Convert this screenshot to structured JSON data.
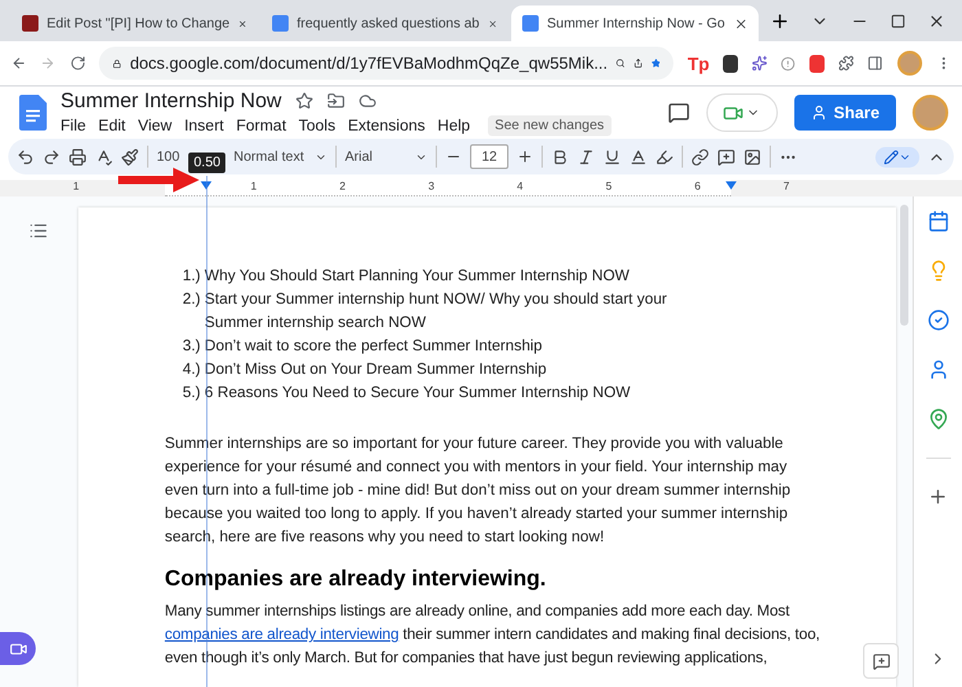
{
  "browser": {
    "tabs": [
      {
        "title": "Edit Post \"[PI] How to Change",
        "kind": "m",
        "selected": false
      },
      {
        "title": "frequently asked questions ab",
        "kind": "g",
        "selected": false
      },
      {
        "title": "Summer Internship Now - Go",
        "kind": "docs",
        "selected": true
      }
    ],
    "url": "docs.google.com/document/d/1y7fEVBaModhmQqZe_qw55Mik...",
    "extension_text": "Tp"
  },
  "doc": {
    "title": "Summer Internship Now",
    "menus": [
      "File",
      "Edit",
      "View",
      "Insert",
      "Format",
      "Tools",
      "Extensions",
      "Help"
    ],
    "changes_chip": "See new changes",
    "share": "Share"
  },
  "toolbar": {
    "zoom": "100",
    "style": "Normal text",
    "font": "Arial",
    "size": "12"
  },
  "ruler": {
    "labels": [
      "1",
      "1",
      "2",
      "3",
      "4",
      "5",
      "6",
      "7"
    ],
    "tooltip": "0.50"
  },
  "content": {
    "list": [
      {
        "number": "1.)",
        "text": "Why You Should Start Planning Your Summer Internship NOW"
      },
      {
        "number": "2.)",
        "text": "Start your Summer internship hunt NOW/ Why you should start your Summer internship search NOW"
      },
      {
        "number": "3.)",
        "text": "Don’t wait to score the perfect Summer Internship"
      },
      {
        "number": "4.)",
        "text": "Don’t Miss Out on Your Dream Summer Internship"
      },
      {
        "number": "5.)",
        "text": " 6 Reasons You Need to Secure Your Summer Internship NOW"
      }
    ],
    "intro": "Summer internships are so important for your future career. They provide you with valuable experience for your résumé and connect you with mentors in your field. Your internship may even turn into a full-time job - mine did! But don’t miss out on your dream summer internship because you waited too long to apply. If you haven’t already started your summer internship search, here are five reasons why you need to start looking now!",
    "heading": "Companies are already interviewing.",
    "para": {
      "before": "Many summer internships listings are already online, and companies add more each day. Most ",
      "link": "companies are already interviewing",
      "after": " their summer intern candidates and making final decisions, too, even though it’s only March. But for companies that have just begun reviewing applications,"
    }
  }
}
